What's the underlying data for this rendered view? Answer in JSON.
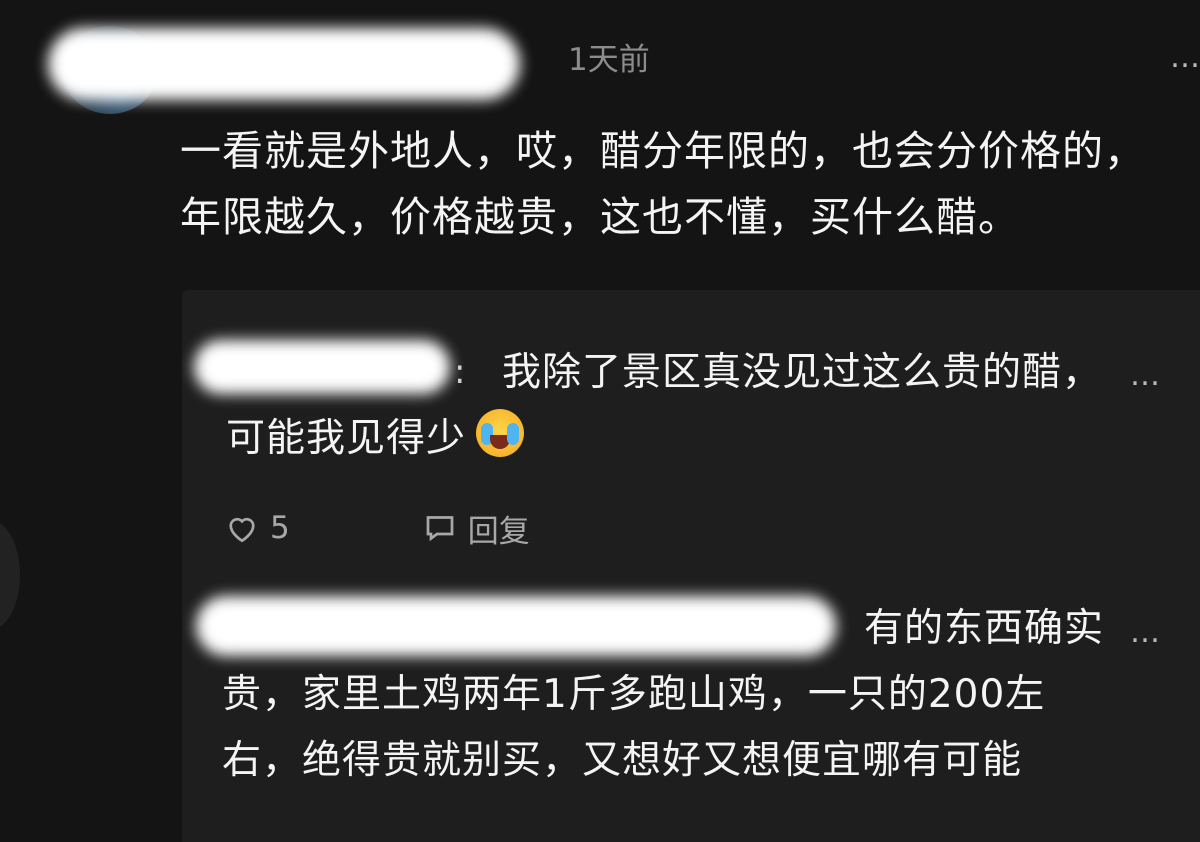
{
  "comment": {
    "time": "1天前",
    "more": "…",
    "text": "一看就是外地人，哎，醋分年限的，也会分价格的，年限越久，价格越贵，这也不懂，买什么醋。"
  },
  "replies": [
    {
      "separator": ":",
      "text": "我除了景区真没见过这么贵的醋，可能我见得少",
      "emoji": "crying-laughing-emoji",
      "more": "…",
      "likes": "5",
      "reply_label": "回复"
    },
    {
      "text": "有的东西确实贵，家里土鸡两年1斤多跑山鸡，一只的200左右，绝得贵就别买，又想好又想便宜哪有可能",
      "more": "…"
    }
  ],
  "colors": {
    "background": "#141414",
    "reply_background": "#1e1e1e",
    "text": "#f4f4f4",
    "muted": "#8c8c8c"
  }
}
